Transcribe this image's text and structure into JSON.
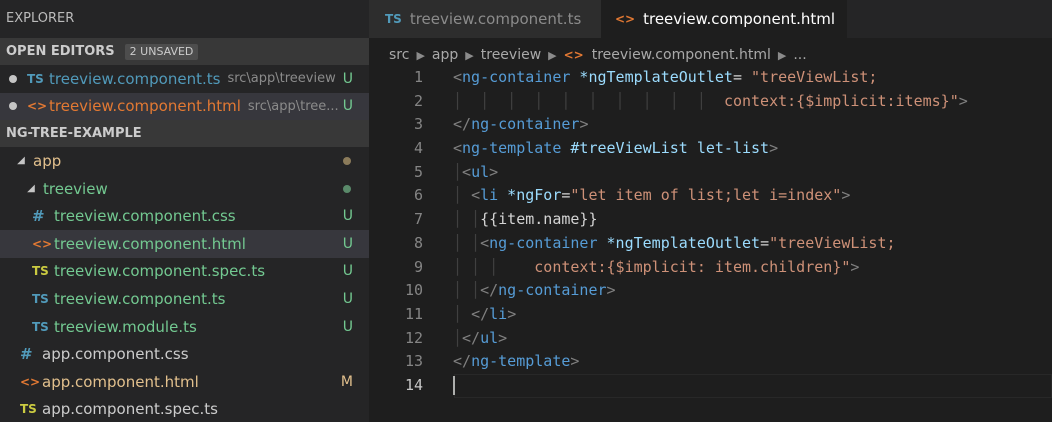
{
  "explorer": {
    "title": "EXPLORER"
  },
  "open_editors": {
    "title": "OPEN EDITORS",
    "badge": "2 UNSAVED",
    "items": [
      {
        "icon": "TS",
        "name": "treeview.component.ts",
        "path": "src\\app\\treeview",
        "status": "U"
      },
      {
        "icon": "<>",
        "name": "treeview.component.html",
        "path": "src\\app\\tree...",
        "status": "U"
      }
    ]
  },
  "project": {
    "title": "NG-TREE-EXAMPLE",
    "tree": [
      {
        "twisty": "◢",
        "name": "app"
      },
      {
        "twisty": "◢",
        "name": "treeview"
      },
      {
        "icon": "#",
        "name": "treeview.component.css",
        "status": "U"
      },
      {
        "icon": "<>",
        "name": "treeview.component.html",
        "status": "U"
      },
      {
        "icon": "TS",
        "name": "treeview.component.spec.ts",
        "status": "U"
      },
      {
        "icon": "TS",
        "name": "treeview.component.ts",
        "status": "U"
      },
      {
        "icon": "TS",
        "name": "treeview.module.ts",
        "status": "U"
      },
      {
        "icon": "#",
        "name": "app.component.css"
      },
      {
        "icon": "<>",
        "name": "app.component.html",
        "status": "M"
      },
      {
        "icon": "TS",
        "name": "app.component.spec.ts"
      }
    ]
  },
  "tabs": [
    {
      "icon": "TS",
      "label": "treeview.component.ts"
    },
    {
      "icon": "<>",
      "label": "treeview.component.html"
    }
  ],
  "breadcrumb": [
    "src",
    "app",
    "treeview",
    "treeview.component.html",
    "..."
  ],
  "breadcrumb_icon": "<>",
  "editor": {
    "line_numbers": [
      "1",
      "2",
      "3",
      "4",
      "5",
      "6",
      "7",
      "8",
      "9",
      "10",
      "11",
      "12",
      "13",
      "14"
    ],
    "lines": [
      {
        "a": "<",
        "b": "ng-container",
        "c": " *ngTemplateOutlet",
        "d": "= ",
        "e": "\"treeViewList;"
      },
      {
        "e": "context:{$implicit:items}\"",
        "f": ">"
      },
      {
        "a": "</",
        "b": "ng-container",
        "f": ">"
      },
      {
        "a": "<",
        "b": "ng-template",
        "c": " #treeViewList let-list",
        "f": ">"
      },
      {
        "a": "<",
        "b": "ul",
        "f": ">"
      },
      {
        "a": "<",
        "b": "li",
        "c": " *ngFor",
        "d": "=",
        "e": "\"let item of list;let i=index\"",
        "f": ">"
      },
      {
        "t": "{{item.name}}"
      },
      {
        "a": "<",
        "b": "ng-container",
        "c": " *ngTemplateOutlet",
        "d": "=",
        "e": "\"treeViewList;"
      },
      {
        "e": "context:{$implicit: item.children}\"",
        "f": ">"
      },
      {
        "a": "</",
        "b": "ng-container",
        "f": ">"
      },
      {
        "a": "</",
        "b": "li",
        "f": ">"
      },
      {
        "a": "</",
        "b": "ul",
        "f": ">"
      },
      {
        "a": "</",
        "b": "ng-template",
        "f": ">"
      },
      {}
    ]
  }
}
